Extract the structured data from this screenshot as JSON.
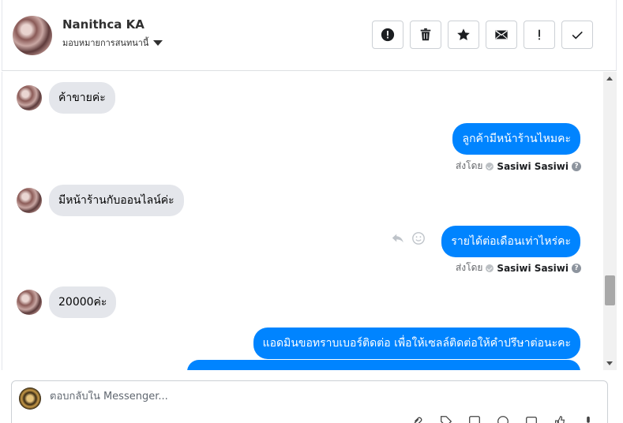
{
  "contact": {
    "name": "Nanithca KA",
    "assign_label": "มอบหมายการสนทนานี้"
  },
  "toolbar": {
    "buttons": [
      {
        "icon": "alert-circle-icon"
      },
      {
        "icon": "trash-icon"
      },
      {
        "icon": "star-icon"
      },
      {
        "icon": "envelope-icon"
      },
      {
        "icon": "exclamation-icon"
      },
      {
        "icon": "check-icon"
      }
    ]
  },
  "messages": [
    {
      "direction": "in",
      "text": "ค้าขายค่ะ"
    },
    {
      "direction": "out",
      "text": "ลูกค้ามีหน้าร้านไหมคะ",
      "sent_by_label": "ส่งโดย",
      "sent_by_name": "Sasiwi Sasiwi"
    },
    {
      "direction": "in",
      "text": "มีหน้าร้านกับออนไลน์ค่ะ"
    },
    {
      "direction": "out",
      "text": "รายได้ต่อเดือนเท่าไหร่คะ",
      "sent_by_label": "ส่งโดย",
      "sent_by_name": "Sasiwi Sasiwi"
    },
    {
      "direction": "in",
      "text": "20000ค่ะ"
    },
    {
      "direction": "out",
      "text": "แอดมินขอทราบเบอร์ติดต่อ เพื่อให้เซลล์ติดต่อให้คำปรึษาต่อนะคะ"
    }
  ],
  "composer": {
    "placeholder": "ตอบกลับใน Messenger..."
  },
  "colors": {
    "outgoing_bubble": "#0084ff",
    "incoming_bubble": "#e4e6eb"
  }
}
